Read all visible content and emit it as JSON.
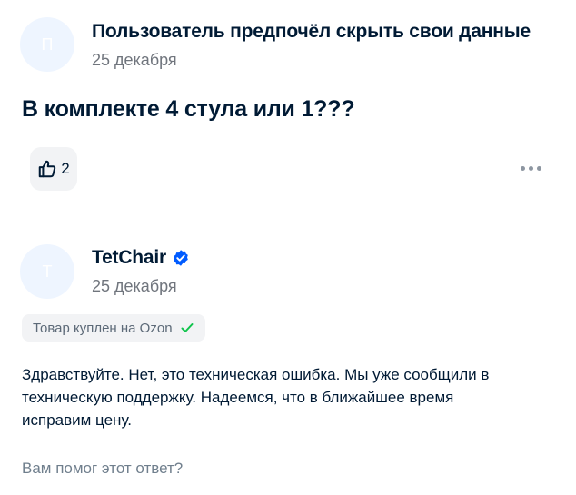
{
  "question": {
    "avatar_letter": "П",
    "author": "Пользователь предпочёл скрыть свои данные",
    "date": "25 декабря",
    "text": "В комплекте 4 стула или 1???",
    "likes": "2"
  },
  "answer": {
    "avatar_letter": "T",
    "author": "TetChair",
    "verified_icon": "verified-check-icon",
    "date": "25 декабря",
    "purchase_badge": "Товар куплен на Ozon",
    "text": "Здравствуйте. Нет, это техническая ошибка. Мы уже сообщили в техническую поддержку. Надеемся, что в ближайшее время исправим цену.",
    "helpful_prompt": "Вам помог этот ответ?"
  },
  "colors": {
    "accent": "#005bff",
    "badge_check": "#10c44c",
    "avatar_bg": "#eef5ff"
  }
}
